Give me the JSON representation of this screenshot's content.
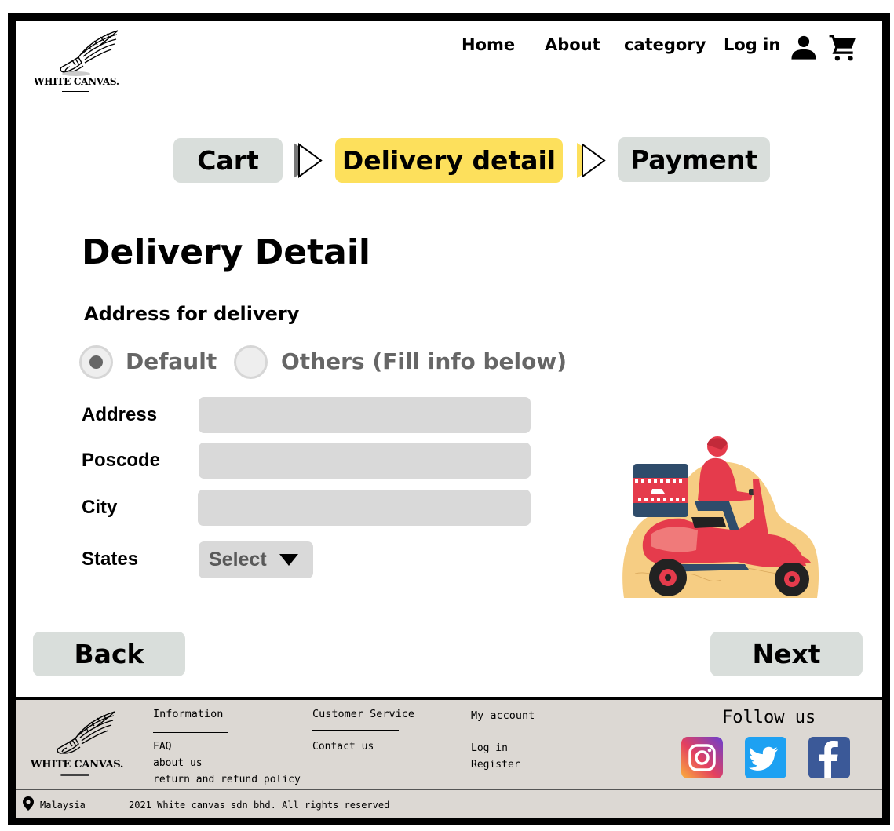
{
  "brand": {
    "name": "WHITE CANVAS."
  },
  "nav": {
    "home": "Home",
    "about": "About",
    "category": "category",
    "login": "Log in"
  },
  "steps": [
    {
      "label": "Cart"
    },
    {
      "label": "Delivery detail"
    },
    {
      "label": "Payment"
    }
  ],
  "page": {
    "title": "Delivery Detail",
    "subtitle": "Address for delivery"
  },
  "radios": {
    "default_label": "Default",
    "others_label": "Others (Fill info below)",
    "selected": "Default"
  },
  "form": {
    "address_label": "Address",
    "address_value": "",
    "poscode_label": "Poscode",
    "poscode_value": "",
    "city_label": "City",
    "city_value": "",
    "states_label": "States",
    "states_value": "Select"
  },
  "buttons": {
    "back": "Back",
    "next": "Next"
  },
  "footer": {
    "information": {
      "title": "Information",
      "links": [
        "FAQ",
        "about us",
        "return and refund policy"
      ]
    },
    "customer_service": {
      "title": "Customer Service",
      "links": [
        "Contact us"
      ]
    },
    "my_account": {
      "title": "My account",
      "links": [
        "Log in",
        "Register"
      ]
    },
    "follow_us": "Follow us",
    "location": "Malaysia",
    "copyright": "2021 White canvas sdn bhd. All rights reserved"
  },
  "colors": {
    "accent_yellow": "#fde05c",
    "button_gray": "#d9dedb",
    "input_gray": "#d9d9d9",
    "footer_bg": "#dcd8d3"
  },
  "icons": [
    "user-icon",
    "cart-icon",
    "location-pin-icon",
    "instagram-icon",
    "twitter-icon",
    "facebook-icon"
  ]
}
